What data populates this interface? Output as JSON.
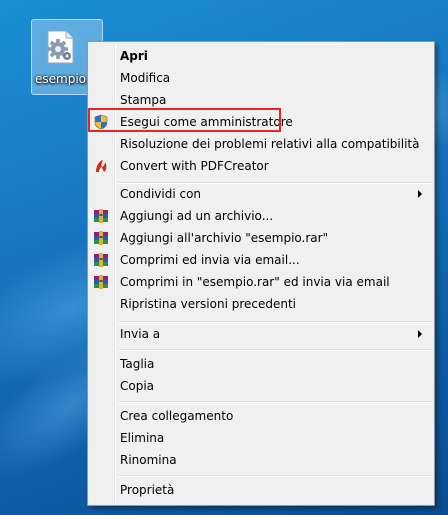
{
  "desktop": {
    "icon_label": "esempio.b",
    "icon_name": "config-file-gear-icon"
  },
  "menu": {
    "items": [
      {
        "label": "Apri",
        "bold": true
      },
      {
        "label": "Modifica"
      },
      {
        "label": "Stampa"
      },
      {
        "label": "Esegui come amministratore",
        "icon": "uac-shield-icon",
        "highlighted": true
      },
      {
        "label": "Risoluzione dei problemi relativi alla compatibilità"
      },
      {
        "label": "Convert with PDFCreator",
        "icon": "pdfcreator-icon"
      },
      {
        "label": "Condividi con",
        "submenu": true
      },
      {
        "label": "Aggiungi ad un archivio...",
        "icon": "winrar-icon"
      },
      {
        "label": "Aggiungi all'archivio \"esempio.rar\"",
        "icon": "winrar-icon"
      },
      {
        "label": "Comprimi ed invia via email...",
        "icon": "winrar-icon"
      },
      {
        "label": "Comprimi in \"esempio.rar\" ed invia via email",
        "icon": "winrar-icon"
      },
      {
        "label": "Ripristina versioni precedenti"
      },
      {
        "label": "Invia a",
        "submenu": true
      },
      {
        "label": "Taglia"
      },
      {
        "label": "Copia"
      },
      {
        "label": "Crea collegamento"
      },
      {
        "label": "Elimina"
      },
      {
        "label": "Rinomina"
      },
      {
        "label": "Proprietà"
      }
    ]
  },
  "colors": {
    "highlight_border": "#e8261c",
    "menu_background": "#f0f0f0",
    "desktop_blue": "#1878c2"
  }
}
